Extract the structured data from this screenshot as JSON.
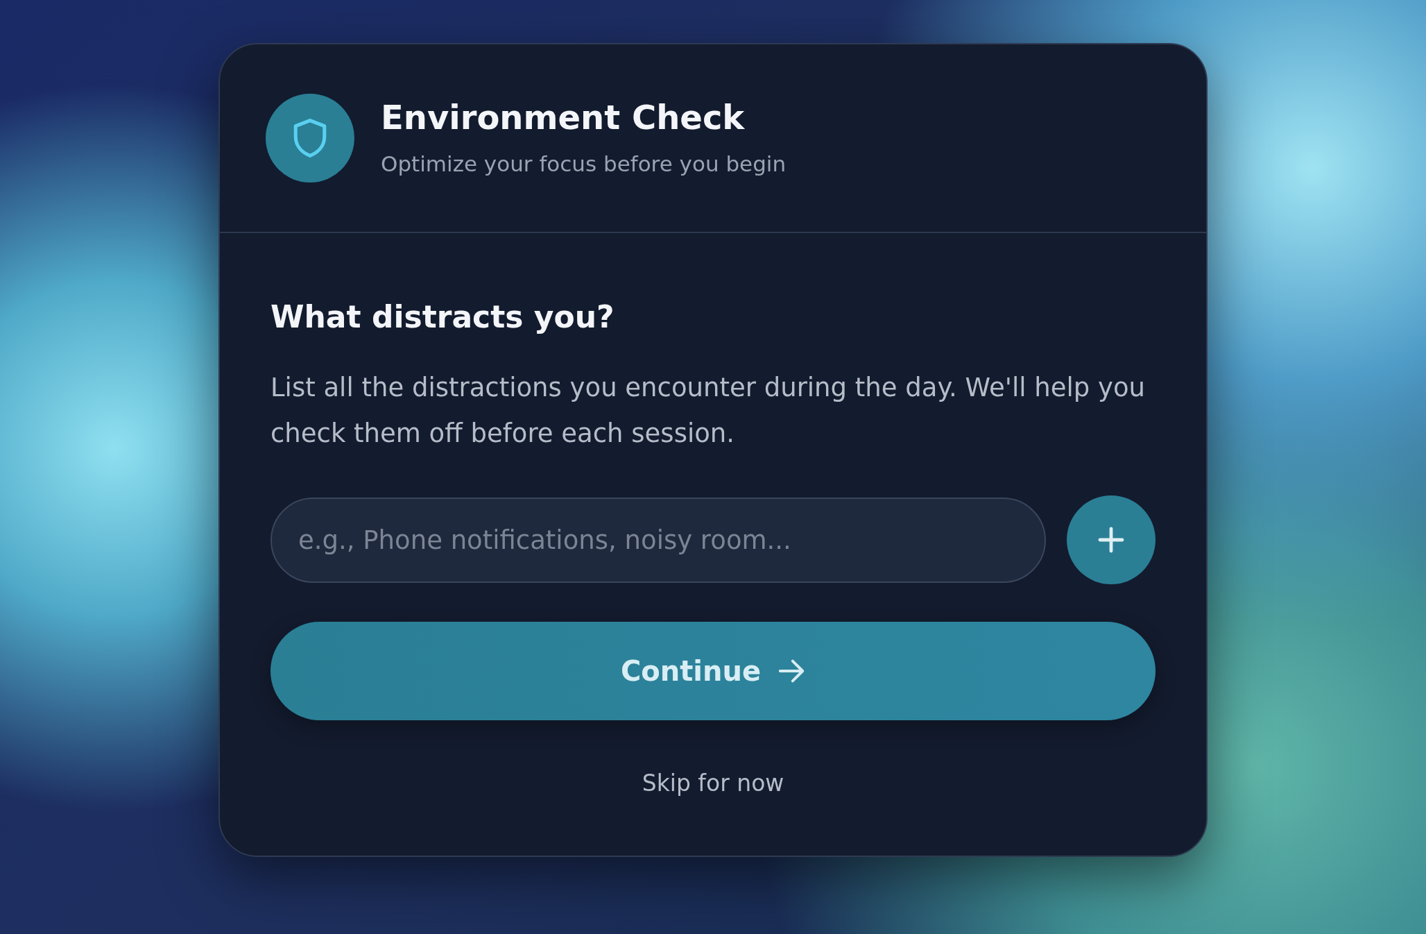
{
  "header": {
    "title": "Environment Check",
    "subtitle": "Optimize your focus before you begin"
  },
  "question": {
    "heading": "What distracts you?",
    "description": "List all the distractions you encounter during the day. We'll help you check them off before each session."
  },
  "input": {
    "placeholder": "e.g., Phone notifications, noisy room..."
  },
  "continue_button": {
    "label": "Continue"
  },
  "skip_link": {
    "label": "Skip for now"
  }
}
